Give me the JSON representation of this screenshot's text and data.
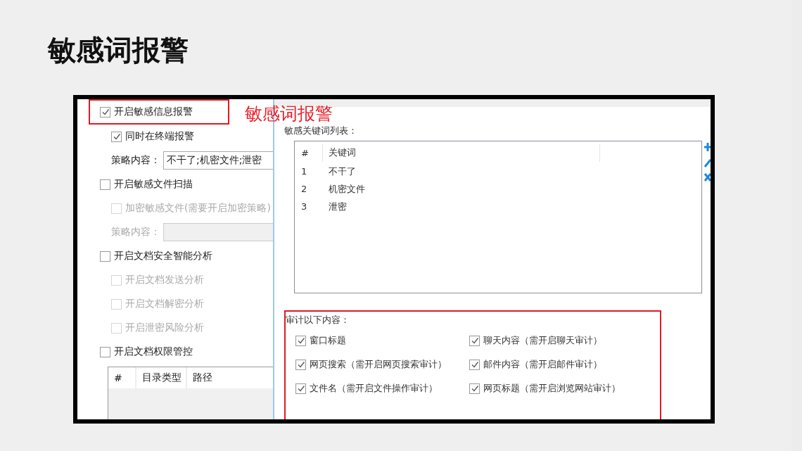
{
  "title": "敏感词报警",
  "annotation": "敏感词报警",
  "left_panel": {
    "options": [
      {
        "label": "开启敏感信息报警",
        "checked": true,
        "disabled": false,
        "highlighted": true,
        "children": [
          {
            "kind": "checkbox",
            "label": "同时在终端报警",
            "checked": true,
            "disabled": false
          },
          {
            "kind": "field",
            "label": "策略内容：",
            "value": "不干了;机密文件;泄密",
            "disabled": false
          }
        ]
      },
      {
        "label": "开启敏感文件扫描",
        "checked": false,
        "disabled": false,
        "highlighted": false,
        "children": [
          {
            "kind": "checkbox",
            "label": "加密敏感文件(需要开启加密策略)",
            "checked": false,
            "disabled": true
          },
          {
            "kind": "field",
            "label": "策略内容：",
            "disabled": true
          }
        ]
      },
      {
        "label": "开启文档安全智能分析",
        "checked": false,
        "disabled": false,
        "highlighted": false,
        "children": [
          {
            "kind": "checkbox",
            "label": "开启文档发送分析",
            "checked": false,
            "disabled": true
          },
          {
            "kind": "checkbox",
            "label": "开启文档解密分析",
            "checked": false,
            "disabled": true
          },
          {
            "kind": "checkbox",
            "label": "开启泄密风险分析",
            "checked": false,
            "disabled": true
          }
        ]
      },
      {
        "label": "开启文档权限管控",
        "checked": false,
        "disabled": false,
        "highlighted": false
      }
    ],
    "table": {
      "columns": [
        "#",
        "目录类型",
        "路径"
      ]
    }
  },
  "keyword_list": {
    "label": "敏感关键词列表：",
    "columns": [
      "#",
      "关键词"
    ],
    "rows": [
      {
        "index": "1",
        "keyword": "不干了"
      },
      {
        "index": "2",
        "keyword": "机密文件"
      },
      {
        "index": "3",
        "keyword": "泄密"
      }
    ]
  },
  "audit": {
    "label": "审计以下内容：",
    "items": [
      {
        "label": "窗口标题",
        "checked": true
      },
      {
        "label": "聊天内容（需开启聊天审计）",
        "checked": true
      },
      {
        "label": "网页搜索（需开启网页搜索审计）",
        "checked": true
      },
      {
        "label": "邮件内容（需开启邮件审计）",
        "checked": true
      },
      {
        "label": "文件名（需开启文件操作审计）",
        "checked": true
      },
      {
        "label": "网页标题（需开启浏览网站审计）",
        "checked": true
      }
    ]
  }
}
